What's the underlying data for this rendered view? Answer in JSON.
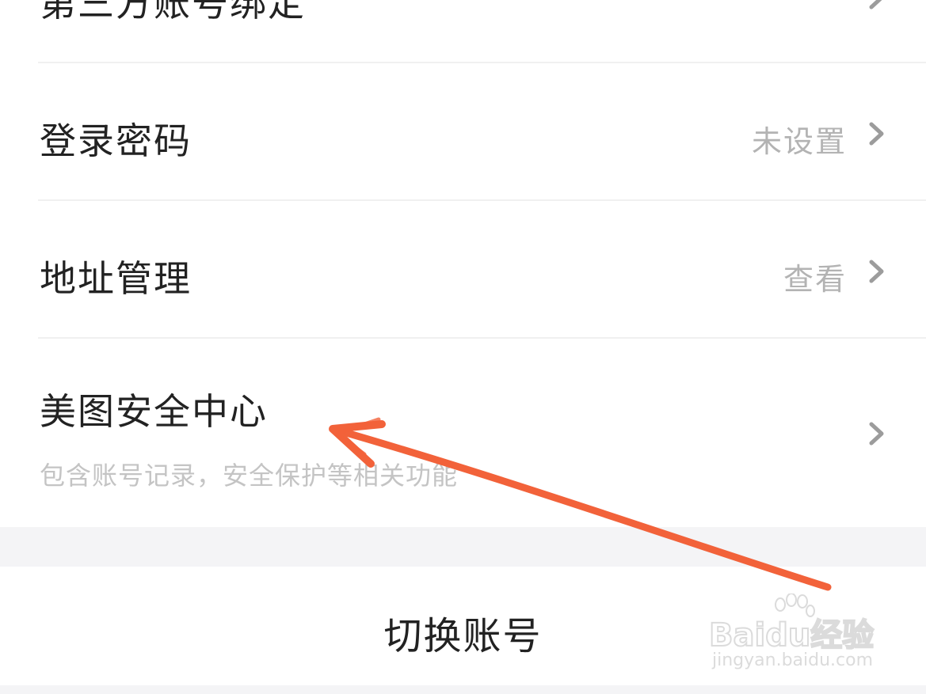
{
  "settings": {
    "items": [
      {
        "label": "第三方账号绑定",
        "value": ""
      },
      {
        "label": "登录密码",
        "value": "未设置"
      },
      {
        "label": "地址管理",
        "value": "查看"
      },
      {
        "label": "美图安全中心",
        "value": "",
        "subtitle": "包含账号记录，安全保护等相关功能"
      }
    ]
  },
  "actions": {
    "switch_account": "切换账号"
  },
  "annotation": {
    "arrow_color": "#f2623a"
  },
  "watermark": {
    "brand": "Baidu经验",
    "url": "jingyan.baidu.com"
  },
  "icons": {
    "chevron": "chevron-right-icon"
  }
}
